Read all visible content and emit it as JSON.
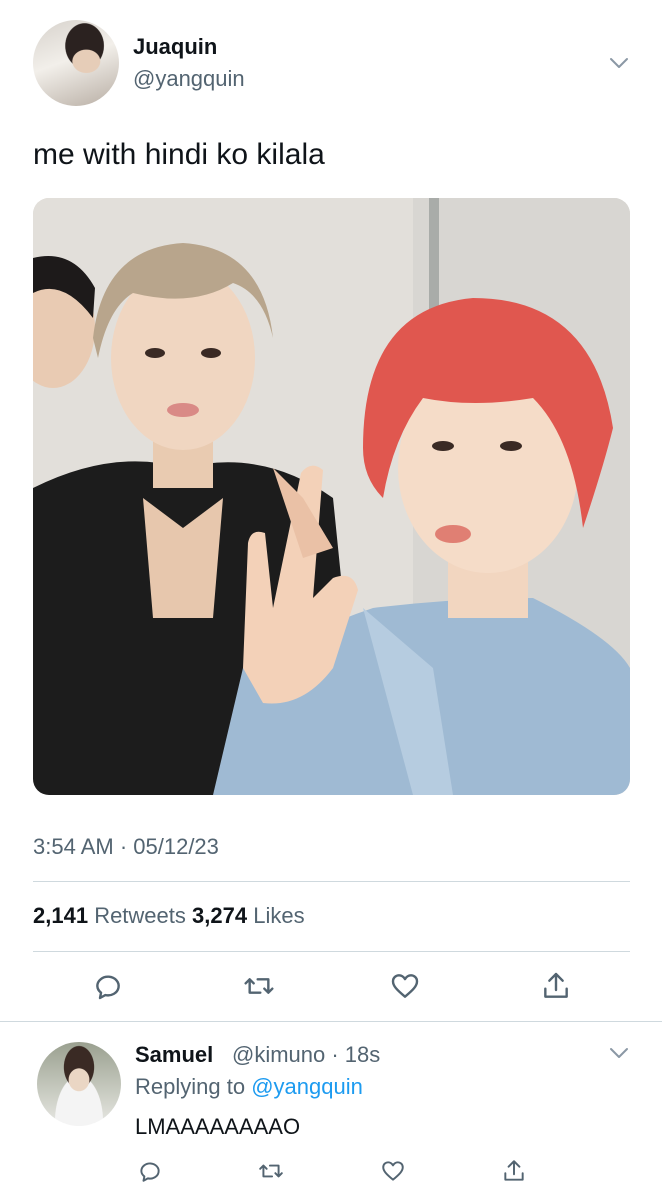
{
  "tweet": {
    "author": {
      "name": "Juaquin",
      "handle": "@yangquin"
    },
    "text": "me with hindi ko kilala",
    "timestamp": "3:54 AM · 05/12/23",
    "stats": {
      "retweets_count": "2,141",
      "retweets_label": "Retweets",
      "likes_count": "3,274",
      "likes_label": "Likes"
    },
    "actions": [
      "reply-icon",
      "retweet-icon",
      "like-icon",
      "share-icon"
    ]
  },
  "reply": {
    "author": {
      "name": "Samuel",
      "handle": "@kimuno · 18s"
    },
    "replying_prefix": "Replying to",
    "replying_mention": "@yangquin",
    "text": "LMAAAAAAAAO",
    "actions": [
      "reply-icon",
      "retweet-icon",
      "like-icon",
      "share-icon"
    ]
  },
  "colors": {
    "text": "#0f1419",
    "secondary": "#536471",
    "accent": "#1d9bf0",
    "divider": "#cfd9de"
  }
}
